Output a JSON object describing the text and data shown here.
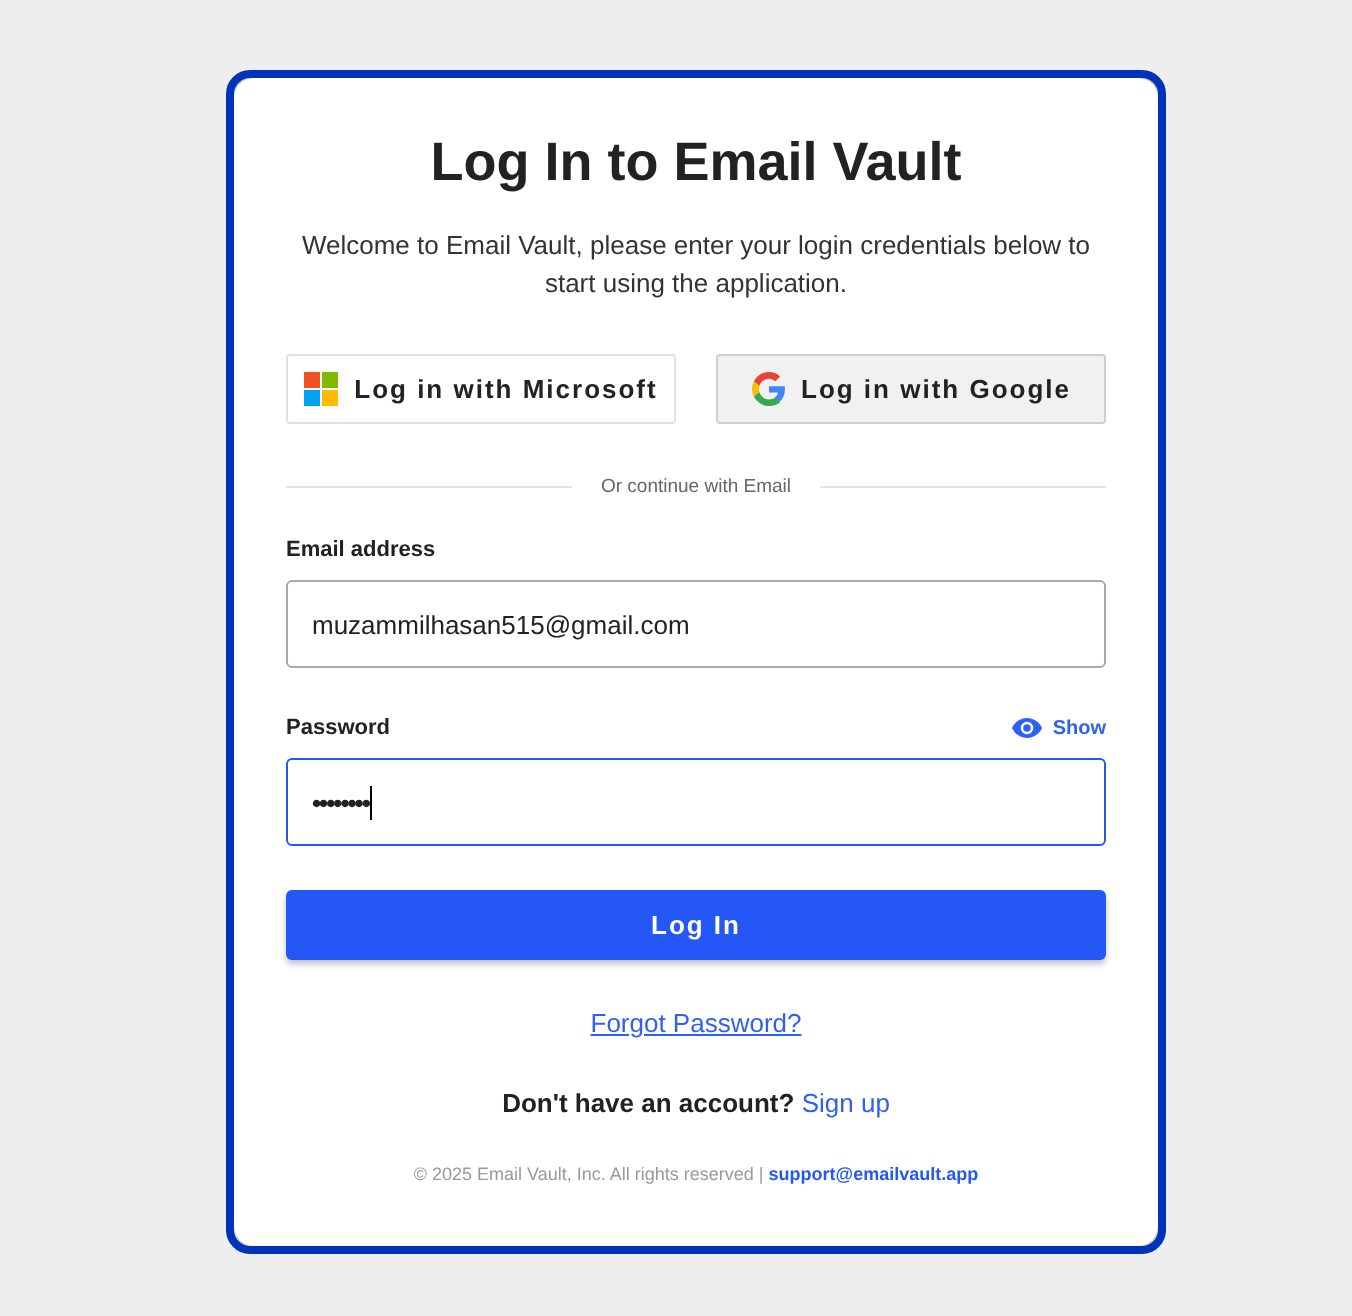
{
  "title": "Log In to Email Vault",
  "subtitle": "Welcome to Email Vault, please enter your login credentials below to start using the application.",
  "social_buttons": [
    {
      "kind": "microsoft",
      "label": "Log in with Microsoft",
      "hovered": false
    },
    {
      "kind": "google",
      "label": "Log in with Google",
      "hovered": true
    }
  ],
  "divider": "Or continue with Email",
  "email": {
    "label": "Email address",
    "value": "muzammilhasan515@gmail.com",
    "focused": false
  },
  "password": {
    "label": "Password",
    "value": "••••••••",
    "focused": true,
    "toggle": "Show"
  },
  "login_button": "Log In",
  "forgot_link": "Forgot Password?",
  "signup": {
    "text": "Don't have an account?",
    "link": "Sign up"
  },
  "footer": {
    "text": "© 2025 Email Vault, Inc. All rights reserved |",
    "link": "support@emailvault.app"
  }
}
